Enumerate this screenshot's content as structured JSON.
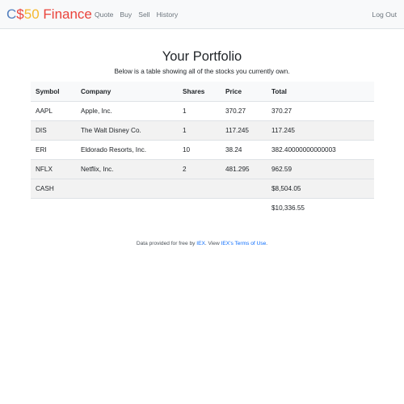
{
  "nav": {
    "brand": {
      "c": "C",
      "dollar": "$",
      "fifty": "50",
      "finance": "Finance",
      "colors": {
        "c": "#537fbe",
        "dollar": "#ea433b",
        "fifty": "#f5b82e",
        "finance": "#2e944b"
      }
    },
    "links": [
      "Quote",
      "Buy",
      "Sell",
      "History"
    ],
    "logout": "Log Out"
  },
  "main": {
    "title": "Your Portfolio",
    "subtitle": "Below is a table showing all of the stocks you currently own.",
    "table": {
      "headers": [
        "Symbol",
        "Company",
        "Shares",
        "Price",
        "Total"
      ],
      "rows": [
        [
          "AAPL",
          "Apple, Inc.",
          "1",
          "370.27",
          "370.27"
        ],
        [
          "DIS",
          "The Walt Disney Co.",
          "1",
          "117.245",
          "117.245"
        ],
        [
          "ERI",
          "Eldorado Resorts, Inc.",
          "10",
          "38.24",
          "382.40000000000003"
        ],
        [
          "NFLX",
          "Netflix, Inc.",
          "2",
          "481.295",
          "962.59"
        ],
        [
          "CASH",
          "",
          "",
          "",
          "$8,504.05"
        ]
      ],
      "grand_total": "$10,336.55"
    }
  },
  "footer": {
    "prefix": "Data provided for free by ",
    "iex": "IEX",
    "middle": ". View ",
    "terms": "IEX's Terms of Use",
    "suffix": "."
  }
}
